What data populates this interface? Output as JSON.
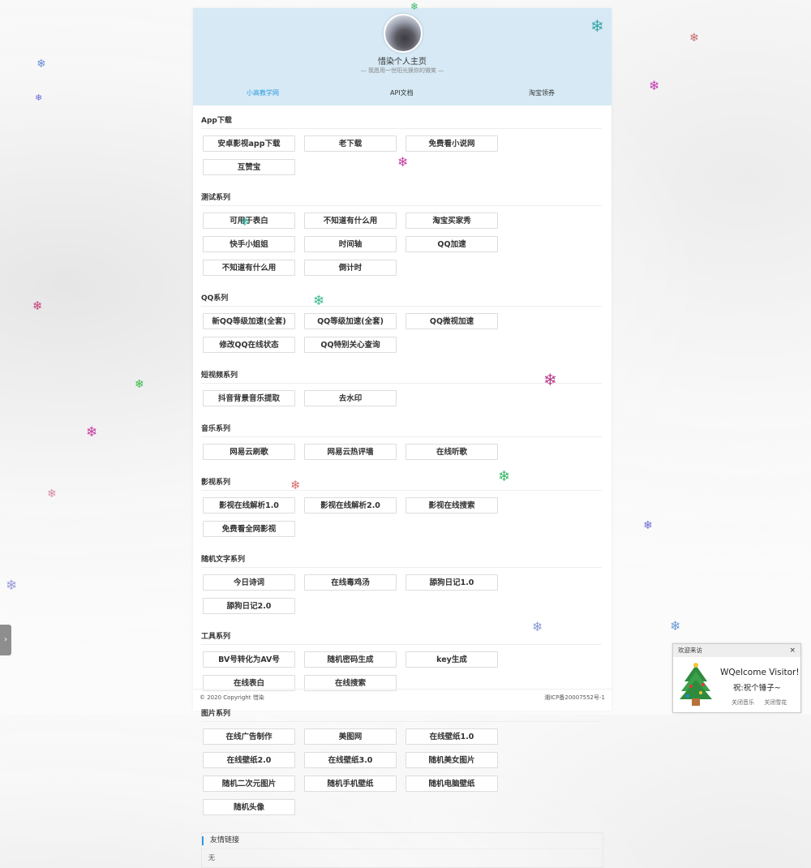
{
  "header": {
    "title": "惜染个人主页",
    "subtitle": "— 我愿用一世阳光换你的微笑 —",
    "nav": [
      "小高教学网",
      "API文档",
      "淘宝领券"
    ]
  },
  "sections": [
    {
      "title": "App下载",
      "items": [
        "安卓影视app下载",
        "老下载",
        "免费看小说网",
        "互赞宝"
      ]
    },
    {
      "title": "测试系列",
      "items": [
        "可用于表白",
        "不知道有什么用",
        "淘宝买家秀",
        "快手小姐姐",
        "时间轴",
        "QQ加速",
        "不知道有什么用",
        "倒计时"
      ]
    },
    {
      "title": "QQ系列",
      "items": [
        "新QQ等级加速(全套)",
        "QQ等级加速(全套)",
        "QQ微视加速",
        "修改QQ在线状态",
        "QQ特别关心查询"
      ]
    },
    {
      "title": "短视频系列",
      "items": [
        "抖音背景音乐提取",
        "去水印"
      ]
    },
    {
      "title": "音乐系列",
      "items": [
        "网易云刷歌",
        "网易云热评墙",
        "在线听歌"
      ]
    },
    {
      "title": "影视系列",
      "items": [
        "影视在线解析1.0",
        "影视在线解析2.0",
        "影视在线搜索",
        "免费看全网影视"
      ]
    },
    {
      "title": "随机文字系列",
      "items": [
        "今日诗词",
        "在线毒鸡汤",
        "舔狗日记1.0",
        "舔狗日记2.0"
      ]
    },
    {
      "title": "工具系列",
      "items": [
        "BV号转化为AV号",
        "随机密码生成",
        "key生成",
        "在线表白",
        "在线搜索"
      ]
    },
    {
      "title": "图片系列",
      "items": [
        "在线广告制作",
        "美图网",
        "在线壁纸1.0",
        "在线壁纸2.0",
        "在线壁纸3.0",
        "随机美女图片",
        "随机二次元图片",
        "随机手机壁纸",
        "随机电脑壁纸",
        "随机头像"
      ]
    }
  ],
  "friends": {
    "title": "友情链接",
    "content": "无"
  },
  "footer": {
    "copyright": "© 2020 Copyright 惜染",
    "icp": "湘ICP备20007552号-1"
  },
  "side_tab": {
    "glyph": "›"
  },
  "welcome": {
    "header": "欢迎来访",
    "close": "×",
    "title": "WQelcome Visitor!",
    "subtitle": "祝:祝个锤子~",
    "links": [
      "关闭音乐",
      "关闭雪花"
    ]
  },
  "colors": {
    "hero": "#d6e9f5",
    "accent": "#2d9be0"
  }
}
